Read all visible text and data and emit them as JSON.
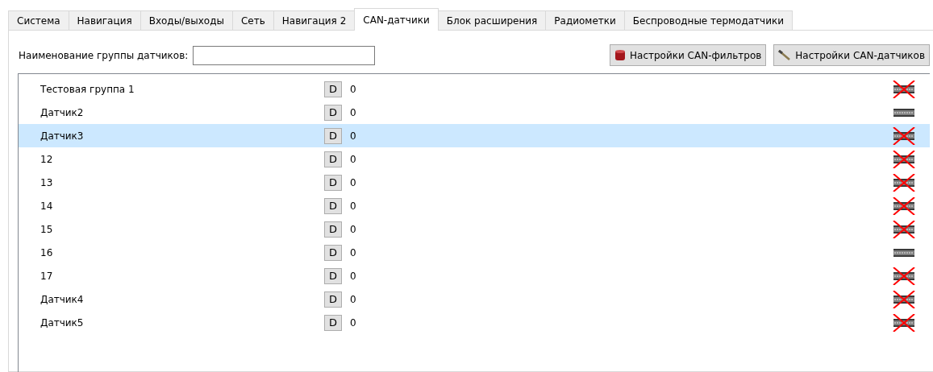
{
  "tabs": [
    {
      "label": "Система",
      "selected": false
    },
    {
      "label": "Навигация",
      "selected": false
    },
    {
      "label": "Входы/выходы",
      "selected": false
    },
    {
      "label": "Сеть",
      "selected": false
    },
    {
      "label": "Навигация 2",
      "selected": false
    },
    {
      "label": "CAN-датчики",
      "selected": true
    },
    {
      "label": "Блок расширения",
      "selected": false
    },
    {
      "label": "Радиометки",
      "selected": false
    },
    {
      "label": "Беспроводные термодатчики",
      "selected": false
    }
  ],
  "group_name": {
    "label": "Наименование группы датчиков:"
  },
  "buttons": [
    {
      "kind": "filter",
      "label": "Настройки CAN-фильтров"
    },
    {
      "kind": "sensor",
      "label": "Настройки CAN-датчиков"
    }
  ],
  "sensors": [
    {
      "name": "Тестовая группа 1",
      "button": "D",
      "value": "0",
      "selected": false,
      "disabled": true
    },
    {
      "name": "Датчик2",
      "button": "D",
      "value": "0",
      "selected": false,
      "disabled": false
    },
    {
      "name": "Датчик3",
      "button": "D",
      "value": "0",
      "selected": true,
      "disabled": true
    },
    {
      "name": "12",
      "button": "D",
      "value": "0",
      "selected": false,
      "disabled": true
    },
    {
      "name": "13",
      "button": "D",
      "value": "0",
      "selected": false,
      "disabled": true
    },
    {
      "name": "14",
      "button": "D",
      "value": "0",
      "selected": false,
      "disabled": true
    },
    {
      "name": "15",
      "button": "D",
      "value": "0",
      "selected": false,
      "disabled": true
    },
    {
      "name": "16",
      "button": "D",
      "value": "0",
      "selected": false,
      "disabled": false
    },
    {
      "name": "17",
      "button": "D",
      "value": "0",
      "selected": false,
      "disabled": true
    },
    {
      "name": "Датчик4",
      "button": "D",
      "value": "0",
      "selected": false,
      "disabled": true
    },
    {
      "name": "Датчик5",
      "button": "D",
      "value": "0",
      "selected": false,
      "disabled": true
    }
  ]
}
